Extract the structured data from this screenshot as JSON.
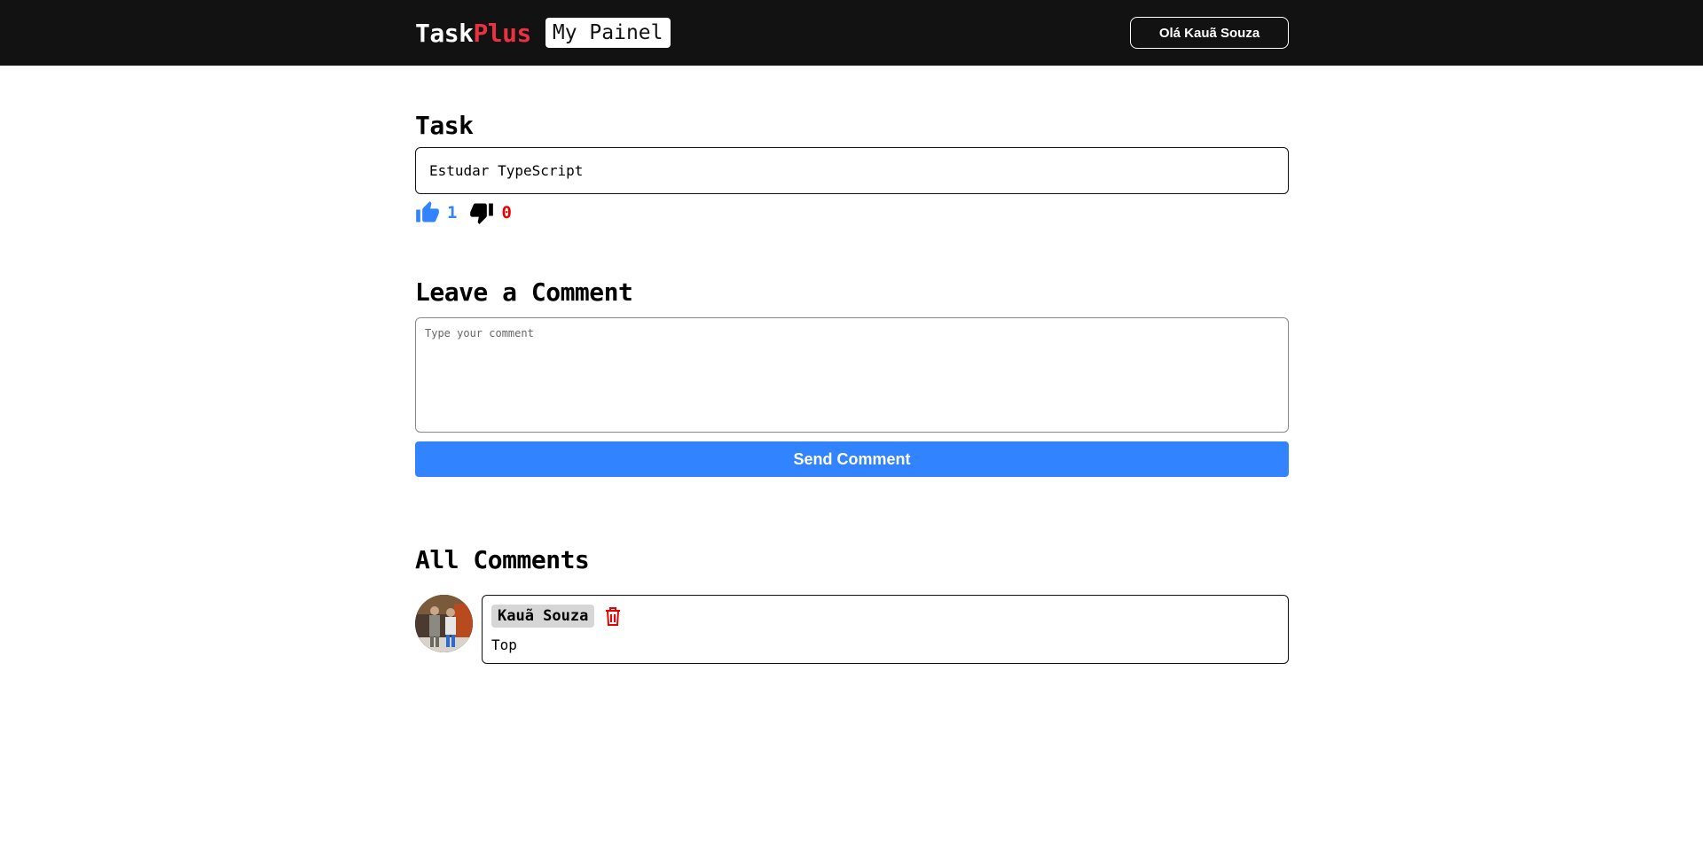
{
  "header": {
    "logo_main": "Task",
    "logo_accent": "Plus",
    "panel_link": "My Painel",
    "user_button": "Olá Kauã Souza"
  },
  "task": {
    "heading": "Task",
    "text": "Estudar TypeScript",
    "likes": "1",
    "dislikes": "0"
  },
  "comment_form": {
    "heading": "Leave a Comment",
    "placeholder": "Type your comment",
    "value": "",
    "send_label": "Send Comment"
  },
  "comments": {
    "heading": "All Comments",
    "items": [
      {
        "author": "Kauã Souza",
        "text": "Top"
      }
    ]
  },
  "colors": {
    "accent_red": "#ea3140",
    "primary_blue": "#3183ff",
    "header_bg": "#121212"
  },
  "icons": {
    "like": "thumbs-up-icon",
    "dislike": "thumbs-down-icon",
    "delete": "trash-icon"
  }
}
